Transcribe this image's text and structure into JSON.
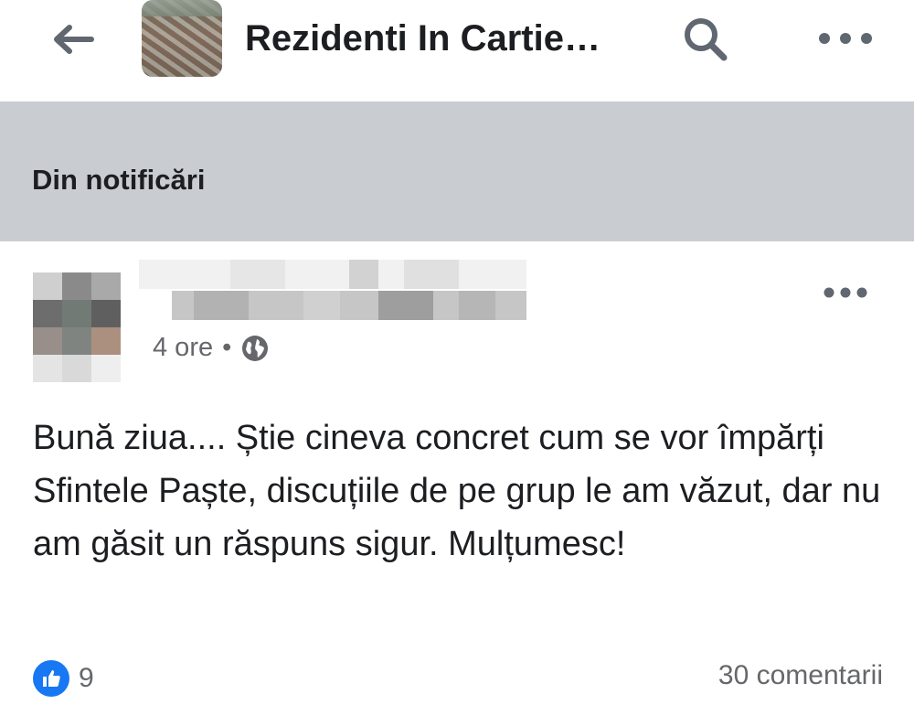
{
  "header": {
    "title": "Rezidenti In Cartie…",
    "back_icon": "arrow-left-icon",
    "search_icon": "search-icon",
    "more_icon": "more-horizontal-icon"
  },
  "notice": {
    "label": "Din notificări"
  },
  "post": {
    "time": "4 ore",
    "separator": "•",
    "privacy_icon": "globe-icon",
    "text": "Bună ziua.... Știe cineva concret cum se vor împărți Sfintele Paște, discuțiile de pe grup le am văzut, dar nu am găsit un răspuns sigur. Mulțumesc!",
    "likes": "9",
    "comments": "30 comentarii"
  },
  "colors": {
    "accent": "#1877f2",
    "notice_bg": "#c9ccd1",
    "secondary_text": "#65676b",
    "icon_gray": "#606770"
  }
}
